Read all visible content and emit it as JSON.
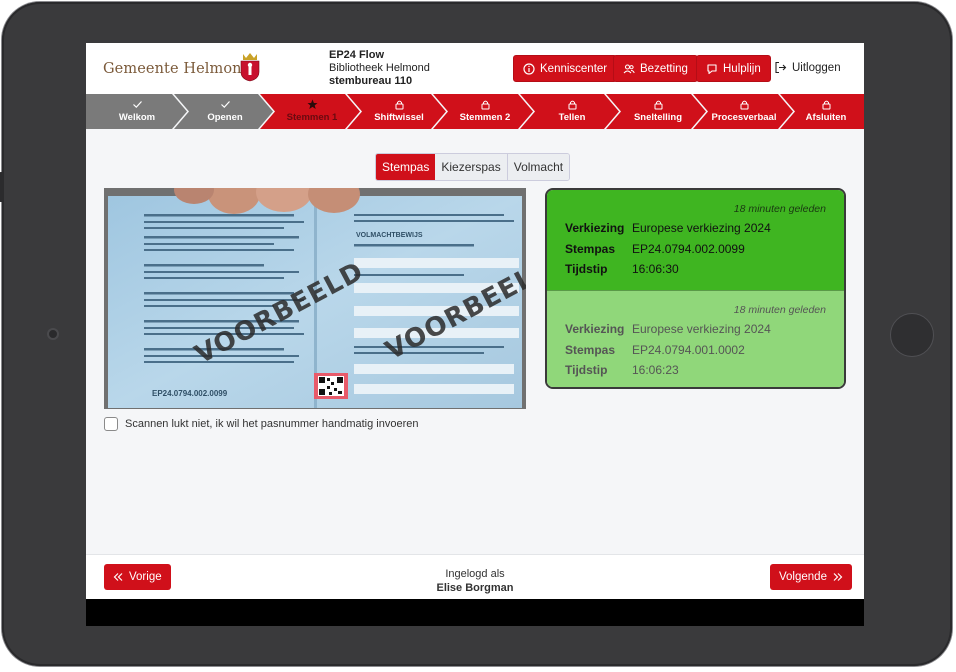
{
  "brand": {
    "name": "Gemeente Helmond"
  },
  "session": {
    "app": "EP24 Flow",
    "location": "Bibliotheek Helmond",
    "office": "stembureau 110"
  },
  "header": {
    "buttons": [
      {
        "label": "Kenniscenter",
        "icon": "info-icon"
      },
      {
        "label": "Bezetting",
        "icon": "users-icon"
      },
      {
        "label": "Hulplijn",
        "icon": "chat-icon"
      }
    ],
    "logout_label": "Uitloggen"
  },
  "steps": [
    {
      "label": "Welkom",
      "state": "done",
      "icon": "check-icon"
    },
    {
      "label": "Openen",
      "state": "done",
      "icon": "check-icon"
    },
    {
      "label": "Stemmen 1",
      "state": "current",
      "icon": "star-icon"
    },
    {
      "label": "Shiftwissel",
      "state": "locked",
      "icon": "lock-icon"
    },
    {
      "label": "Stemmen 2",
      "state": "locked",
      "icon": "lock-icon"
    },
    {
      "label": "Tellen",
      "state": "locked",
      "icon": "lock-icon"
    },
    {
      "label": "Sneltelling",
      "state": "locked",
      "icon": "lock-icon"
    },
    {
      "label": "Procesverbaal",
      "state": "locked",
      "icon": "lock-icon"
    },
    {
      "label": "Afsluiten",
      "state": "locked",
      "icon": "lock-icon"
    }
  ],
  "tabs": [
    {
      "label": "Stempas",
      "active": true
    },
    {
      "label": "Kiezerspas",
      "active": false
    },
    {
      "label": "Volmacht",
      "active": false
    }
  ],
  "scan": {
    "stamp_text": "VOORBEELD",
    "heading_right": "VOLMACHTBEWIJS",
    "code_text": "EP24.0794.002.0099"
  },
  "manual_entry_label": "Scannen lukt niet, ik wil het pasnummer handmatig invoeren",
  "history_labels": {
    "election": "Verkiezing",
    "pass": "Stempas",
    "time": "Tijdstip"
  },
  "history": [
    {
      "ago": "18 minuten geleden",
      "election": "Europese verkiezing 2024",
      "pass": "EP24.0794.002.0099",
      "time": "16:06:30"
    },
    {
      "ago": "18 minuten geleden",
      "election": "Europese verkiezing 2024",
      "pass": "EP24.0794.001.0002",
      "time": "16:06:23"
    }
  ],
  "footer": {
    "prev_label": "Vorige",
    "next_label": "Volgende",
    "logged_in_label": "Ingelogd als",
    "user_name": "Elise Borgman"
  },
  "colors": {
    "accent": "#d0101a",
    "done_step": "#7a7a7a",
    "success": "#3fb521",
    "success_light": "#90d77a",
    "brand_text": "#7b5a3a"
  }
}
